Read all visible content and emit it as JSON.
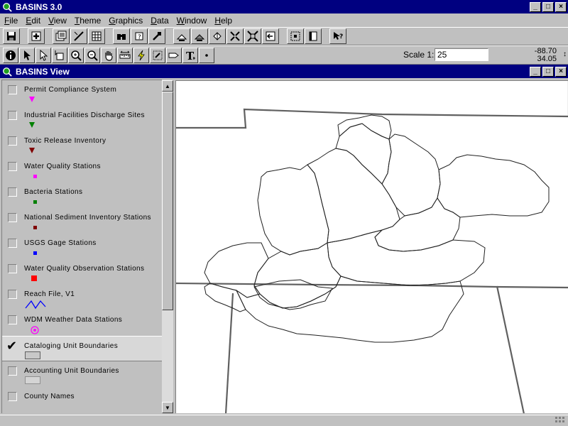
{
  "app": {
    "title": "BASINS 3.0"
  },
  "window_buttons": {
    "minimize": "_",
    "maximize": "□",
    "close": "×"
  },
  "menu": [
    {
      "label": "File",
      "accel": "F",
      "rest": "ile"
    },
    {
      "label": "Edit",
      "accel": "E",
      "rest": "dit"
    },
    {
      "label": "View",
      "accel": "V",
      "rest": "iew"
    },
    {
      "label": "Theme",
      "accel": "T",
      "rest": "heme"
    },
    {
      "label": "Graphics",
      "accel": "G",
      "rest": "raphics"
    },
    {
      "label": "Data",
      "accel": "D",
      "rest": "ata"
    },
    {
      "label": "Window",
      "accel": "W",
      "rest": "indow"
    },
    {
      "label": "Help",
      "accel": "H",
      "rest": "elp"
    }
  ],
  "scale": {
    "label": "Scale 1:",
    "value": "25"
  },
  "coords": {
    "x": "-88.70",
    "y": "34.05"
  },
  "view": {
    "title": "BASINS View"
  },
  "themes": [
    {
      "name": "Permit Compliance System",
      "checked": false,
      "symbol": "triangle",
      "color": "#ff00ff"
    },
    {
      "name": "Industrial Facilities Discharge Sites",
      "checked": false,
      "symbol": "triangle",
      "color": "#008000"
    },
    {
      "name": "Toxic Release Inventory",
      "checked": false,
      "symbol": "triangle",
      "color": "#800000"
    },
    {
      "name": "Water Quality Stations",
      "checked": false,
      "symbol": "square",
      "color": "#ff00ff"
    },
    {
      "name": "Bacteria Stations",
      "checked": false,
      "symbol": "square",
      "color": "#008000"
    },
    {
      "name": "National Sediment Inventory Stations",
      "checked": false,
      "symbol": "square",
      "color": "#800000"
    },
    {
      "name": "USGS Gage Stations",
      "checked": false,
      "symbol": "square",
      "color": "#0000ff"
    },
    {
      "name": "Water Quality Observation Stations",
      "checked": false,
      "symbol": "bigsquare",
      "color": "#ff0000"
    },
    {
      "name": "Reach File, V1",
      "checked": false,
      "symbol": "line",
      "color": "#0000ff"
    },
    {
      "name": "WDM Weather Data Stations",
      "checked": false,
      "symbol": "target",
      "color": "#ff00ff"
    },
    {
      "name": "Cataloging Unit Boundaries",
      "checked": true,
      "symbol": "polygon",
      "color": "#606060"
    },
    {
      "name": "Accounting Unit Boundaries",
      "checked": false,
      "symbol": "polygon-light",
      "color": "#909090"
    },
    {
      "name": "County Names",
      "checked": false,
      "symbol": "none",
      "color": ""
    }
  ],
  "colors": {
    "titlebar": "#000080",
    "chrome": "#c0c0c0",
    "map_line": "#404040"
  }
}
